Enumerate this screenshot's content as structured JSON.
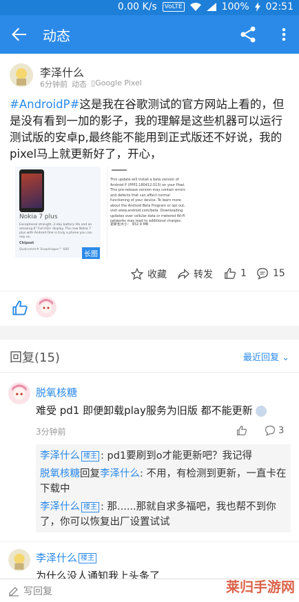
{
  "status": {
    "speed": "0.00 K/s",
    "volte": "VoLTE",
    "battery": "100%",
    "time": "02:51"
  },
  "appbar": {
    "title": "动态"
  },
  "post": {
    "username": "李泽什么",
    "time": "6分钟前",
    "category": "动态",
    "device": "Google Pixel",
    "hashtag": "#AndroidP#",
    "text": "这是我在谷歌测试的官方网站上看的，但是没有看到一加的影子，我的理解是这些机器可以运行测试版的安卓p,最终能不能用到正式版还不好说，我的pixel马上就更新好了，开心，",
    "thumb1_title": "Nokia 7 plus",
    "thumb1_text": "Exceptional strength, 2-day battery life and an amazing 6\" Full HD+ display. The new Nokia 7 plus with Android One is truly a phone you can rely on.",
    "thumb1_spec_label": "Chipset",
    "thumb1_spec_value": "Qualcomm® Snapdragon™ 660",
    "thumb2_text": "This update will install a beta version of Android P (PPP2.180412.013) on your Pixel. This pre-release version may contain errors and defects that can affect normal functioning of your device. To learn more about the Android Beta Program or opt out, visit www.android.com/beta. Downloading updates over cellular data or metered Wi-Fi networks may lead to additional charges.",
    "thumb2_size": "更新包大小：  932.9 MB",
    "long_badge": "长图",
    "actions": {
      "fav": "收藏",
      "forward": "转发",
      "likes": "1",
      "comments": "15"
    }
  },
  "replies": {
    "header": "回复(15)",
    "sort": "最近回复",
    "comment1": {
      "username": "脱氧核糖",
      "text": "难受 pd1 即便卸载play服务为旧版 都不能更新",
      "time": "3分钟前",
      "comment_count": "3",
      "subs": [
        {
          "user": "李泽什么",
          "badge": "楼主",
          "text": ": pd1要刷到o才能更新吧？我记得"
        },
        {
          "user": "脱氧核糖",
          "mid": "回复",
          "target": "李泽什么",
          "text": ": 不用，有检测到更新，一直卡在下载中"
        },
        {
          "user": "李泽什么",
          "badge": "楼主",
          "text": ": 那......那就自求多福吧，我也帮不到你了，你可以恢复出厂设置试试"
        }
      ]
    },
    "comment2": {
      "username": "李泽什么",
      "badge": "楼主",
      "text": "为什么没人通知我上头条了"
    }
  },
  "bottom": {
    "write": "写回复"
  },
  "watermark": "莱归手游网",
  "colors": {
    "accent": "#2b8ae8",
    "statusbar": "#1e7fd9"
  }
}
